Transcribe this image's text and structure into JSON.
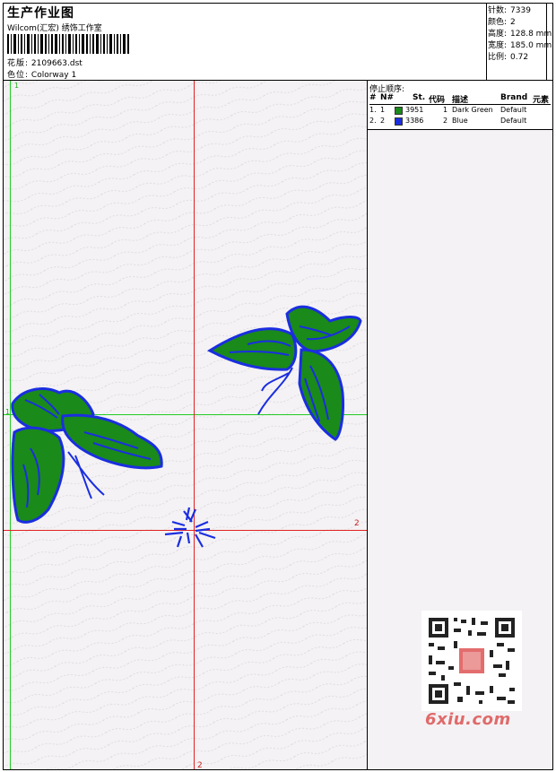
{
  "header": {
    "title": "生产作业图",
    "subtitle": "Wilcom(汇宏) 绣饰工作室",
    "design_label": "花版:",
    "design_value": "2109663.dst",
    "colorway_label": "色位:",
    "colorway_value": "Colorway 1"
  },
  "stats": [
    {
      "label": "针数:",
      "value": "7339"
    },
    {
      "label": "颜色:",
      "value": "2"
    },
    {
      "label": "高度:",
      "value": "128.8 mm"
    },
    {
      "label": "宽度:",
      "value": "185.0 mm"
    },
    {
      "label": "比例:",
      "value": "0.72"
    }
  ],
  "stop_sequence": {
    "title": "停止顺序:",
    "columns": [
      "#",
      "N#",
      "St.",
      "代码",
      "描述",
      "Brand",
      "元素"
    ],
    "rows": [
      {
        "idx": "1.",
        "n": "1",
        "st": "3951",
        "code": "1",
        "desc": "Dark Green",
        "brand": "Default",
        "color": "#1a8a1a"
      },
      {
        "idx": "2.",
        "n": "2",
        "st": "3386",
        "code": "2",
        "desc": "Blue",
        "brand": "Default",
        "color": "#1a2ee0"
      }
    ]
  },
  "guides": {
    "top_marker": "1",
    "left_marker": "1",
    "right_marker": "2",
    "bottom_marker": "2"
  },
  "watermark": {
    "brand": "6xiu.com"
  },
  "colors": {
    "thread_green": "#1a8a1a",
    "thread_blue": "#1a2ee0",
    "guide_red": "#e32020",
    "guide_green": "#22cc22"
  }
}
